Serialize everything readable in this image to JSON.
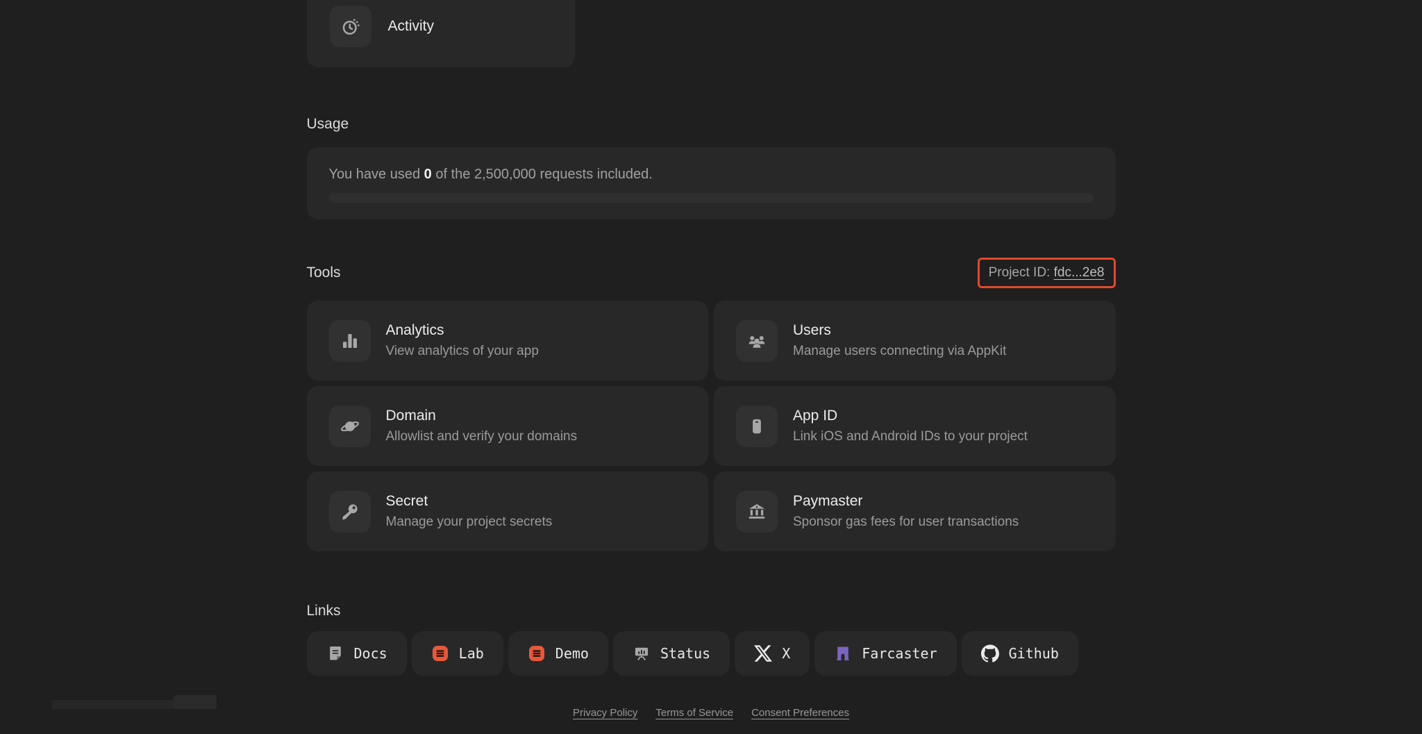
{
  "activity_card": {
    "label": "Activity",
    "icon": "timer-icon"
  },
  "usage": {
    "heading": "Usage",
    "line": {
      "prefix": "You have used ",
      "used": "0",
      "suffix": " of the 2,500,000 requests included."
    },
    "progress_percent": 0
  },
  "tools": {
    "heading": "Tools",
    "project_id": {
      "label": "Project ID: ",
      "value": "fdc...2e8"
    },
    "cards": [
      {
        "id": "analytics",
        "icon": "bar-chart-icon",
        "title": "Analytics",
        "description": "View analytics of your app"
      },
      {
        "id": "users",
        "icon": "users-icon",
        "title": "Users",
        "description": "Manage users connecting via AppKit"
      },
      {
        "id": "domain",
        "icon": "planet-icon",
        "title": "Domain",
        "description": "Allowlist and verify your domains"
      },
      {
        "id": "app-id",
        "icon": "phone-icon",
        "title": "App ID",
        "description": "Link iOS and Android IDs to your project"
      },
      {
        "id": "secret",
        "icon": "key-icon",
        "title": "Secret",
        "description": "Manage your project secrets"
      },
      {
        "id": "paymaster",
        "icon": "bank-icon",
        "title": "Paymaster",
        "description": "Sponsor gas fees for user transactions"
      }
    ]
  },
  "links": {
    "heading": "Links",
    "items": [
      {
        "id": "docs",
        "icon": "document-icon",
        "label": "Docs"
      },
      {
        "id": "lab",
        "icon": "reown-logo-icon",
        "label": "Lab"
      },
      {
        "id": "demo",
        "icon": "reown-logo-icon",
        "label": "Demo"
      },
      {
        "id": "status",
        "icon": "status-board-icon",
        "label": "Status"
      },
      {
        "id": "x",
        "icon": "x-logo-icon",
        "label": "X"
      },
      {
        "id": "farcaster",
        "icon": "farcaster-icon",
        "label": "Farcaster"
      },
      {
        "id": "github",
        "icon": "github-icon",
        "label": "Github"
      }
    ]
  },
  "footer": {
    "links": [
      "Privacy Policy",
      "Terms of Service",
      "Consent Preferences"
    ]
  },
  "colors": {
    "annotation_red": "#e1492b",
    "brand_orange": "#e7583b",
    "farcaster_purple": "#7c65c1"
  }
}
